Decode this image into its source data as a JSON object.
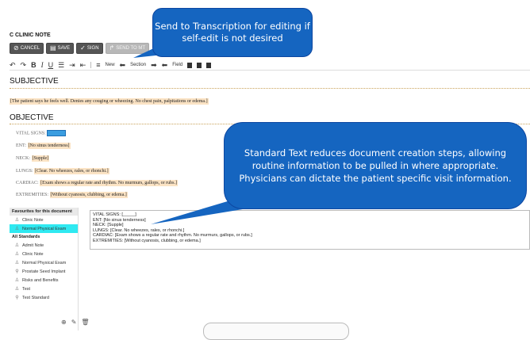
{
  "header": {
    "title": "C CLINIC NOTE"
  },
  "toolbar": {
    "cancel": "CANCEL",
    "save": "SAVE",
    "sign": "SIGN",
    "send": "SEND TO MT",
    "new": "New",
    "section": "Section",
    "field": "Field"
  },
  "sections": {
    "subjective": "SUBJECTIVE",
    "subjective_text": "[The patient says he feels well.  Denies any couging or wheezing.  No chest pain, palpitations or edema.]",
    "objective": "OBJECTIVE",
    "fields": [
      {
        "label": "VITAL SIGNS:",
        "value": ""
      },
      {
        "label": "ENT:",
        "value": "[No sinus tenderness]"
      },
      {
        "label": "NECK:",
        "value": "[Supple]"
      },
      {
        "label": "LUNGS:",
        "value": "[Clear. No wheezes, rales, or rhonchi.]"
      },
      {
        "label": "CARDIAC:",
        "value": "[Exam shows a regular rate and rhythm. No murmurs, gallops, or rubs.]"
      },
      {
        "label": "EXTREMITIES:",
        "value": "[Without cyanosis, clubbing, or edema.]"
      }
    ]
  },
  "panel": {
    "favourites_header": "Favourites for this document",
    "favourites": [
      {
        "label": "Clinic Note",
        "icon": "people-icon"
      },
      {
        "label": "Normal Physical Exam",
        "icon": "people-icon"
      }
    ],
    "all_header": "All Standards",
    "all": [
      {
        "label": "Admit Note",
        "icon": "people-icon"
      },
      {
        "label": "Clinic Note",
        "icon": "people-icon"
      },
      {
        "label": "Normal Physical Exam",
        "icon": "people-icon"
      },
      {
        "label": "Prostate Seed Implant",
        "icon": "pin-icon"
      },
      {
        "label": "Risks and Benefits",
        "icon": "people-icon"
      },
      {
        "label": "Test",
        "icon": "people-icon"
      },
      {
        "label": "Test Standard",
        "icon": "pin-icon"
      }
    ]
  },
  "preview": {
    "lines": [
      "VITAL SIGNS: [_____]",
      "ENT: [No sinus tenderness]",
      "NECK: [Supple]",
      "LUNGS: [Clear. No wheezes, rales, or rhonchi.]",
      "CARDIAC: [Exam shows a regular rate and rhythm. No murmurs, gallops, or rubs.]",
      "EXTREMITIES: [Without cyanosis, clubbing, or edema.]"
    ]
  },
  "callouts": {
    "top": "Send to Transcription for editing if self-edit is not desired",
    "middle": "Standard Text reduces document creation steps, allowing routine information to be pulled in where appropriate. Physicians can dictate the patient specific visit information."
  },
  "colors": {
    "callout": "#1565c0",
    "highlight": "#fbe3c4",
    "selected": "#2fe9f1"
  }
}
